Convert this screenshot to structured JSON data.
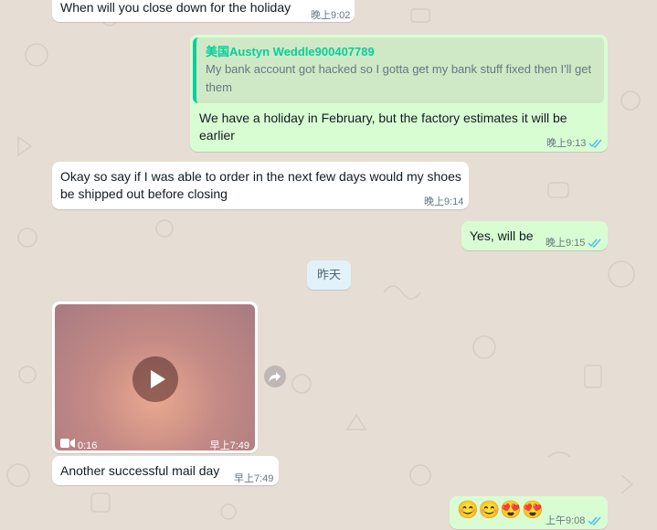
{
  "messages": [
    {
      "text": "When will you close down for the holiday",
      "time": "晚上9:02"
    },
    {
      "quote_name": "美国Austyn Weddle900407789",
      "quote_text": "My bank account got hacked so I gotta get my bank stuff fixed then I'll get them",
      "text_line1": "We have a holiday in February, but the factory estimates it will be",
      "text_line2": "earlier",
      "time": "晚上9:13"
    },
    {
      "text_line1": "Okay so say if I was able to order in the next few days would my shoes",
      "text_line2": "be shipped out before closing",
      "time": "晚上9:14"
    },
    {
      "text": "Yes, will be",
      "time": "晚上9:15"
    },
    {
      "video_duration": "0:16",
      "video_time": "早上7:49",
      "caption": "Another successful mail day",
      "time": "早上7:49"
    },
    {
      "emoji": "😊😊😍😍",
      "time": "上午9:08"
    }
  ],
  "date_divider": "昨天",
  "icons": {
    "play": "play-icon",
    "video": "video-camera-icon",
    "forward": "forward-icon",
    "read": "double-check-icon"
  },
  "colors": {
    "incoming": "#ffffff",
    "outgoing": "#d9fdd3",
    "read_ticks": "#53bdeb",
    "quote_accent": "#06cf9c"
  }
}
